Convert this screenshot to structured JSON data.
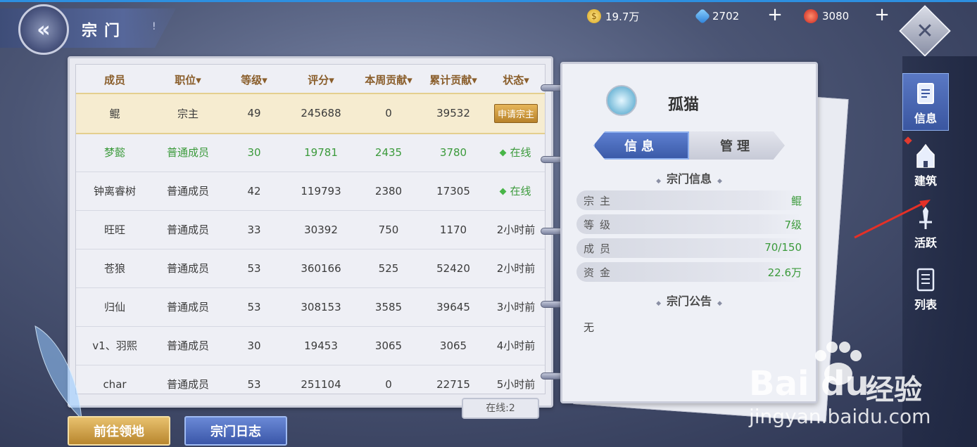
{
  "header": {
    "title": "宗门",
    "info_icon": "!"
  },
  "resources": {
    "gold": "19.7万",
    "gems": "2702",
    "rubies": "3080",
    "plus": "+"
  },
  "close_icon": "✕",
  "table": {
    "headers": [
      "成员",
      "职位▾",
      "等级▾",
      "评分▾",
      "本周贡献▾",
      "累计贡献▾",
      "状态▾"
    ],
    "rows": [
      {
        "name": "鲲",
        "role": "宗主",
        "level": "49",
        "score": "245688",
        "week": "0",
        "total": "39532",
        "status": "申请宗主"
      },
      {
        "name": "梦懿",
        "role": "普通成员",
        "level": "30",
        "score": "19781",
        "week": "2435",
        "total": "3780",
        "status": "在线"
      },
      {
        "name": "钟离睿树",
        "role": "普通成员",
        "level": "42",
        "score": "119793",
        "week": "2380",
        "total": "17305",
        "status": "在线"
      },
      {
        "name": "旺旺",
        "role": "普通成员",
        "level": "33",
        "score": "30392",
        "week": "750",
        "total": "1170",
        "status": "2小时前"
      },
      {
        "name": "苍狼",
        "role": "普通成员",
        "level": "53",
        "score": "360166",
        "week": "525",
        "total": "52420",
        "status": "2小时前"
      },
      {
        "name": "归仙",
        "role": "普通成员",
        "level": "53",
        "score": "308153",
        "week": "3585",
        "total": "39645",
        "status": "3小时前"
      },
      {
        "name": "v1、羽熙",
        "role": "普通成员",
        "level": "30",
        "score": "19453",
        "week": "3065",
        "total": "3065",
        "status": "4小时前"
      },
      {
        "name": "char",
        "role": "普通成员",
        "level": "53",
        "score": "251104",
        "week": "0",
        "total": "22715",
        "status": "5小时前"
      }
    ]
  },
  "online_count": "在线:2",
  "sect": {
    "name": "孤猫",
    "tabs": [
      "信息",
      "管理"
    ],
    "info_heading": "宗门信息",
    "info": [
      {
        "key": "宗主",
        "value": "鲲"
      },
      {
        "key": "等级",
        "value": "7级"
      },
      {
        "key": "成员",
        "value": "70/150"
      },
      {
        "key": "资金",
        "value": "22.6万"
      }
    ],
    "notice_heading": "宗门公告",
    "notice": "无"
  },
  "nav": [
    {
      "label": "信息",
      "icon": "scroll-icon"
    },
    {
      "label": "建筑",
      "icon": "building-icon"
    },
    {
      "label": "活跃",
      "icon": "sword-icon"
    },
    {
      "label": "列表",
      "icon": "list-icon"
    }
  ],
  "buttons": {
    "territory": "前往领地",
    "log": "宗门日志"
  },
  "watermark": {
    "logo": "Bai  du",
    "cn": "经验",
    "url": "jingyan.baidu.com"
  },
  "colors": {
    "online_green": "#3b9a3b",
    "header_brown": "#8a5e2b",
    "accent_blue": "#3b5aa8",
    "gold": "#b8862e"
  }
}
